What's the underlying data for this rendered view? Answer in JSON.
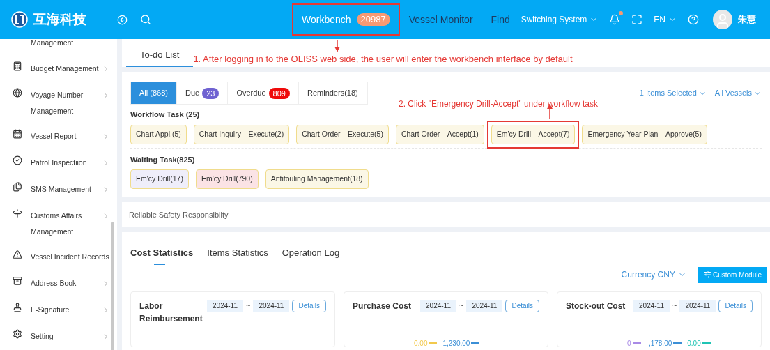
{
  "header": {
    "brand": "互海科技",
    "nav": [
      {
        "label": "Workbench",
        "badge": "20987",
        "selected": true,
        "highlighted": true
      },
      {
        "label": "Vessel Monitor",
        "selected": false,
        "highlighted": false
      },
      {
        "label": "Find",
        "selected": false,
        "highlighted": false
      }
    ],
    "switch_system": "Switching System",
    "language": "EN",
    "user": "朱慧",
    "notification_dot": true
  },
  "sidebar": {
    "items": [
      {
        "label": "Management",
        "has_arrow": false
      },
      {
        "label": "Budget Management",
        "has_arrow": true
      },
      {
        "label": "Voyage Number Management",
        "has_arrow": true
      },
      {
        "label": "Vessel Report",
        "has_arrow": true
      },
      {
        "label": "Patrol Inspectiion",
        "has_arrow": true
      },
      {
        "label": "SMS Management",
        "has_arrow": true
      },
      {
        "label": "Customs Affairs Management",
        "has_arrow": true
      },
      {
        "label": "Vessel Incident Records",
        "has_arrow": false
      },
      {
        "label": "Address Book",
        "has_arrow": true
      },
      {
        "label": "E-Signature",
        "has_arrow": true
      },
      {
        "label": "Setting",
        "has_arrow": true
      }
    ]
  },
  "todo_tab": {
    "label": "To-do List",
    "selected": true
  },
  "annotations": [
    "1. After logging in to the OLISS web side, the user will enter the workbench interface by default",
    "2. Click \"Emergency Drill-Accept\" under workflow task"
  ],
  "filters": [
    {
      "label": "All (868)",
      "selected": true
    },
    {
      "label": "Due",
      "badge": "23",
      "color": "#6f62d1",
      "selected": false
    },
    {
      "label": "Overdue",
      "badge": "809",
      "color": "#ef0a0a",
      "selected": false
    },
    {
      "label": "Reminders(18)",
      "selected": false
    }
  ],
  "items_selected": "1 Items Selected",
  "vessels": "All Vessels",
  "sections": [
    {
      "title": "Workflow Task (25)",
      "tags": [
        {
          "label": "Chart Appl.(5)",
          "color": "#fbf7e6",
          "highlighted": false
        },
        {
          "label": "Chart Inquiry—Execute(2)",
          "color": "#fbf7e6",
          "highlighted": false
        },
        {
          "label": "Chart Order—Execute(5)",
          "color": "#fbf7e6",
          "highlighted": false
        },
        {
          "label": "Chart Order—Accept(1)",
          "color": "#fbf7e6",
          "highlighted": false
        },
        {
          "label": "Em'cy Drill—Accept(7)",
          "color": "#fbf7e6",
          "highlighted": true
        },
        {
          "label": "Emergency Year Plan—Approve(5)",
          "color": "#fbf7e6",
          "highlighted": false
        }
      ]
    },
    {
      "title": "Waiting Task(825)",
      "tags": [
        {
          "label": "Em'cy Drill(17)",
          "color": "#efeefa",
          "highlighted": false
        },
        {
          "label": "Em'cy Drill(790)",
          "color": "#fbe3e5",
          "highlighted": false
        },
        {
          "label": "Antifouling Management(18)",
          "color": "#fbf7e6",
          "highlighted": false
        }
      ]
    }
  ],
  "safety": "Reliable Safety Responsibilty",
  "stat_tabs": [
    {
      "label": "Cost Statistics",
      "selected": true
    },
    {
      "label": "Items Statistics",
      "selected": false
    },
    {
      "label": "Operation Log",
      "selected": false
    }
  ],
  "currency": "Currency CNY",
  "custom_module": "Custom Module",
  "cards": [
    {
      "title": "Labor Reimbursement",
      "from": "2024-11",
      "sep": "~",
      "to": "2024-11",
      "details": "Details"
    },
    {
      "title": "Purchase Cost",
      "from": "2024-11",
      "sep": "~",
      "to": "2024-11",
      "details": "Details",
      "labels": [
        {
          "text": "0.00",
          "color": "#f2c94c"
        },
        {
          "text": "1,230.00",
          "color": "#3b8fd6"
        }
      ]
    },
    {
      "title": "Stock-out Cost",
      "from": "2024-11",
      "sep": "~",
      "to": "2024-11",
      "details": "Details",
      "labels": [
        {
          "text": "0",
          "color": "#a98be6"
        },
        {
          "text": "-,178.00",
          "color": "#3b8fd6"
        },
        {
          "text": "0.00",
          "color": "#1fc4b4"
        }
      ]
    }
  ]
}
